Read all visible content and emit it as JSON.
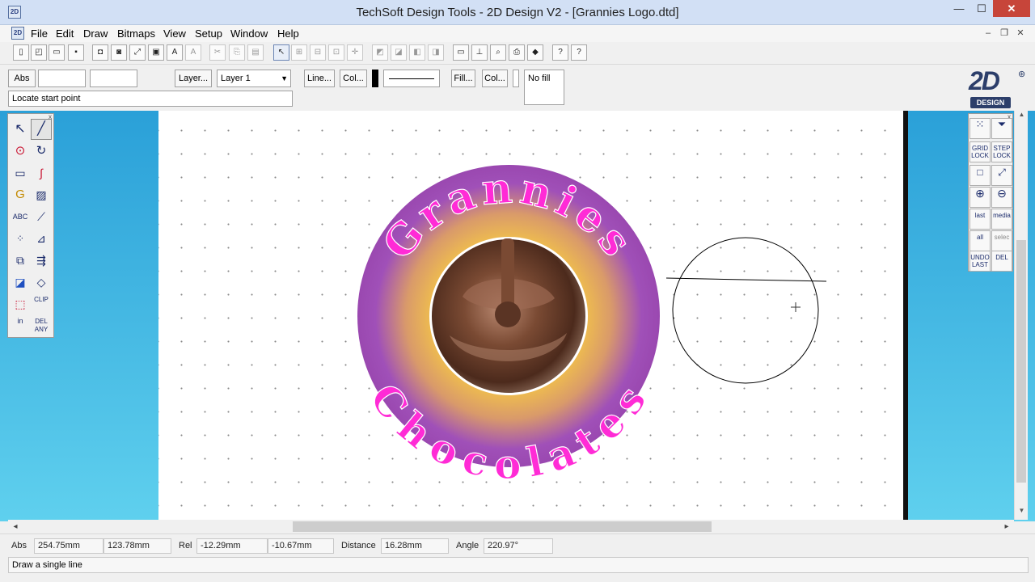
{
  "window": {
    "title": "TechSoft Design Tools - 2D Design V2 - [Grannies Logo.dtd]",
    "app_icon": "2D",
    "min_glyph": "—",
    "max_glyph": "☐",
    "close_glyph": "✕"
  },
  "menubar": {
    "items": [
      "File",
      "Edit",
      "Draw",
      "Bitmaps",
      "View",
      "Setup",
      "Window",
      "Help"
    ],
    "mdi_min": "–",
    "mdi_restore": "❐",
    "mdi_close": "✕"
  },
  "propbar": {
    "abs_label": "Abs",
    "layer_button": "Layer...",
    "layer_value": "Layer 1",
    "line_button": "Line...",
    "line_col_button": "Col...",
    "fill_button": "Fill...",
    "fill_col_button": "Col...",
    "fill_value": "No fill",
    "prompt": "Locate start point"
  },
  "brand": {
    "big": "2D",
    "small": "DESIGN"
  },
  "left_palette": {
    "close": "x",
    "text_tool": "ABC",
    "clip_tool": "CLIP",
    "del_any": "DEL ANY",
    "in_tool": "in"
  },
  "right_palette": {
    "close": "x",
    "grid_lock": "GRID LOCK",
    "step_lock": "STEP LOCK",
    "last": "last",
    "media": "media",
    "all": "all",
    "select": "selec",
    "undo_last": "UNDO LAST",
    "del": "DEL"
  },
  "logo": {
    "top_text": "Grannies",
    "bottom_text": "Chocolates",
    "text_color": "#ff2bd6",
    "ring_color": "#a050b8",
    "glow_color": "#f2c24a"
  },
  "status": {
    "abs_label": "Abs",
    "abs_x": "254.75mm",
    "abs_y": "123.78mm",
    "rel_label": "Rel",
    "rel_x": "-12.29mm",
    "rel_y": "-10.67mm",
    "distance_label": "Distance",
    "distance": "16.28mm",
    "angle_label": "Angle",
    "angle": "220.97°",
    "hint": "Draw a single line"
  }
}
